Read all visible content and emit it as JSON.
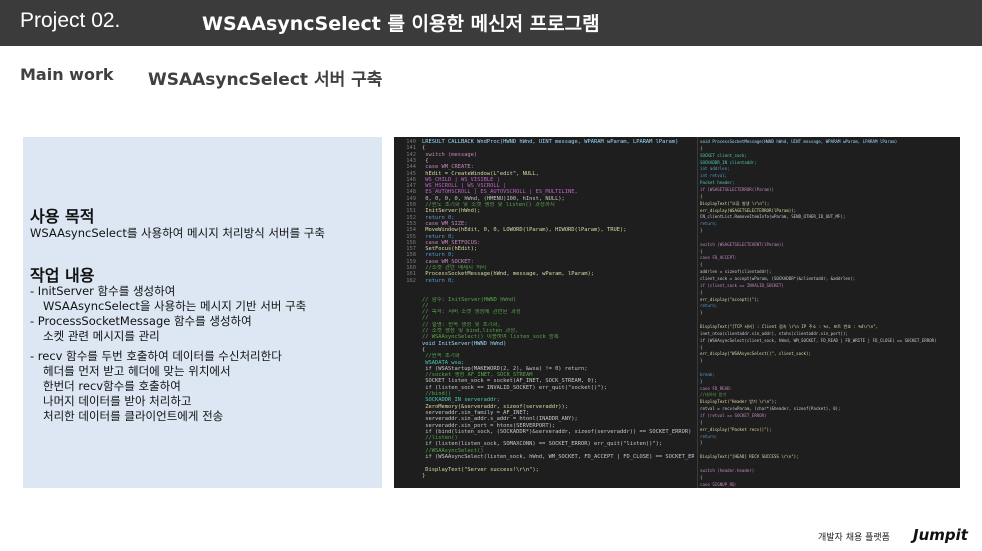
{
  "header": {
    "project": "Project  02.",
    "title": "WSAAsyncSelect 를 이용한 메신저 프로그램"
  },
  "main_work": "Main work",
  "subtitle": "WSAAsyncSelect 서버 구축",
  "left": {
    "purpose_heading": "사용 목적",
    "purpose_text": "WSAAsyncSelect를 사용하여 메시지 처리방식 서버를 구축",
    "work_heading": "작업 내용",
    "lines": [
      "-  InitServer 함수를 생성하여",
      "WSAAsyncSelect을 사용하는 메시지 기반 서버 구축",
      "-  ProcessSocketMessage 함수를 생성하여",
      "소켓 관련 메시지를 관리",
      "-  recv 함수를 두번 호출하여 데이터를 수신처리한다",
      "헤더를 먼저 받고 헤더에 맞는 위치에서",
      "한번더 recv함수를 호출하여",
      "나머지 데이터를 받아 처리하고",
      "처리한 데이터를 클라이언트에게 전송"
    ]
  },
  "code_left": [
    {
      "n": "140",
      "t": "LRESULT CALLBACK WndProc(HWND hWnd, UINT message, WPARAM wParam, LPARAM lParam)",
      "c": "#9cdcfe"
    },
    {
      "n": "141",
      "t": "{",
      "c": "#c8c8c8"
    },
    {
      "n": "142",
      "t": "    switch (message)",
      "c": "#c586c0"
    },
    {
      "n": "143",
      "t": "    {",
      "c": "#c8c8c8"
    },
    {
      "n": "144",
      "t": "    case WM_CREATE:",
      "c": "#c586c0"
    },
    {
      "n": "145",
      "t": "        hEdit = CreateWindow(L\"edit\", NULL,",
      "c": "#dcdcaa"
    },
    {
      "n": "146",
      "t": "            WS_CHILD | WS_VISIBLE |",
      "c": "#bd63c5"
    },
    {
      "n": "147",
      "t": "            WS_HSCROLL | WS_VSCROLL |",
      "c": "#bd63c5"
    },
    {
      "n": "148",
      "t": "            ES_AUTOHSCROLL | ES_AUTOVSCROLL | ES_MULTILINE,",
      "c": "#bd63c5"
    },
    {
      "n": "149",
      "t": "            0, 0, 0, 0, hWnd, (HMENU)100, hInst, NULL);",
      "c": "#c8c8c8"
    },
    {
      "n": "150",
      "t": "        //윈도 초기화 및 소켓 생성 및 listen() 과정까지",
      "c": "#57a64a"
    },
    {
      "n": "151",
      "t": "        InitServer(hWnd);",
      "c": "#dcdcaa"
    },
    {
      "n": "152",
      "t": "        return 0;",
      "c": "#569cd6"
    },
    {
      "n": "153",
      "t": "    case WM_SIZE:",
      "c": "#c586c0"
    },
    {
      "n": "154",
      "t": "        MoveWindow(hEdit, 0, 0, LOWORD(lParam), HIWORD(lParam), TRUE);",
      "c": "#dcdcaa"
    },
    {
      "n": "155",
      "t": "        return 0;",
      "c": "#569cd6"
    },
    {
      "n": "156",
      "t": "    case WM_SETFOCUS:",
      "c": "#c586c0"
    },
    {
      "n": "157",
      "t": "        SetFocus(hEdit);",
      "c": "#dcdcaa"
    },
    {
      "n": "158",
      "t": "        return 0;",
      "c": "#569cd6"
    },
    {
      "n": "159",
      "t": "    case WM_SOCKET:",
      "c": "#c586c0"
    },
    {
      "n": "160",
      "t": "        //소켓 관련 메세지 처리",
      "c": "#57a64a"
    },
    {
      "n": "161",
      "t": "        ProcessSocketMessage(hWnd, message, wParam, lParam);",
      "c": "#dcdcaa"
    },
    {
      "n": "162",
      "t": "        return 0;",
      "c": "#569cd6"
    },
    {
      "n": "",
      "t": "",
      "c": "#c8c8c8"
    },
    {
      "n": "",
      "t": "",
      "c": "#c8c8c8"
    },
    {
      "n": "",
      "t": "//  함수: InitServer(HWND hWnd)",
      "c": "#57a64a"
    },
    {
      "n": "",
      "t": "//",
      "c": "#57a64a"
    },
    {
      "n": "",
      "t": "//  목적:  서버 소켓 생성에 관련된 과정",
      "c": "#57a64a"
    },
    {
      "n": "",
      "t": "//",
      "c": "#57a64a"
    },
    {
      "n": "",
      "t": "//  설명:  윈속 생성 및 초기화,",
      "c": "#57a64a"
    },
    {
      "n": "",
      "t": "//        소켓 생성 및 bind,listen 과정,",
      "c": "#57a64a"
    },
    {
      "n": "",
      "t": "//        WSAAsyncSelect() 이용하여 listen_sock 등록",
      "c": "#57a64a"
    },
    {
      "n": "",
      "t": "void InitServer(HWND hWnd)",
      "c": "#9cdcfe"
    },
    {
      "n": "",
      "t": "{",
      "c": "#c8c8c8"
    },
    {
      "n": "",
      "t": "    //윈속 초기화",
      "c": "#57a64a"
    },
    {
      "n": "",
      "t": "    WSADATA wsa;",
      "c": "#4ec9b0"
    },
    {
      "n": "",
      "t": "    if (WSAStartup(MAKEWORD(2, 2), &wsa) != 0)  return;",
      "c": "#c8c8c8"
    },
    {
      "n": "",
      "t": "    //socket 생성 AF_INET, SOCK_STREAM",
      "c": "#57a64a"
    },
    {
      "n": "",
      "t": "    SOCKET listen_sock = socket(AF_INET, SOCK_STREAM, 0);",
      "c": "#c8c8c8"
    },
    {
      "n": "",
      "t": "    if (listen_sock == INVALID_SOCKET) err_quit(\"socket()\");",
      "c": "#c8c8c8"
    },
    {
      "n": "",
      "t": "    //bind()",
      "c": "#57a64a"
    },
    {
      "n": "",
      "t": "    SOCKADDR_IN serveraddr;",
      "c": "#4ec9b0"
    },
    {
      "n": "",
      "t": "    ZeroMemory(&serveraddr, sizeof(serveraddr));",
      "c": "#dcdcaa"
    },
    {
      "n": "",
      "t": "    serveraddr.sin_family = AF_INET;",
      "c": "#c8c8c8"
    },
    {
      "n": "",
      "t": "    serveraddr.sin_addr.s_addr = htonl(INADDR_ANY);",
      "c": "#c8c8c8"
    },
    {
      "n": "",
      "t": "    serveraddr.sin_port = htons(SERVERPORT);",
      "c": "#c8c8c8"
    },
    {
      "n": "",
      "t": "    if (bind(listen_sock, (SOCKADDR*)&serveraddr, sizeof(serveraddr)) == SOCKET_ERROR) err_quit(\"bind()\");",
      "c": "#c8c8c8"
    },
    {
      "n": "",
      "t": "    //listen()",
      "c": "#57a64a"
    },
    {
      "n": "",
      "t": "    if (listen(listen_sock, SOMAXCONN) == SOCKET_ERROR) err_quit(\"listen()\");",
      "c": "#c8c8c8"
    },
    {
      "n": "",
      "t": "    //WSAAsyncSelect()",
      "c": "#57a64a"
    },
    {
      "n": "",
      "t": "    if (WSAAsyncSelect(listen_sock, hWnd, WM_SOCKET, FD_ACCEPT | FD_CLOSE) == SOCKET_ERROR) err_quit(\"WSAAsyncSelect()\");",
      "c": "#c8c8c8"
    },
    {
      "n": "",
      "t": "",
      "c": "#c8c8c8"
    },
    {
      "n": "",
      "t": "    DisplayText(\"Server success!\\r\\n\");",
      "c": "#dcdcaa"
    },
    {
      "n": "",
      "t": "}",
      "c": "#c8c8c8"
    }
  ],
  "code_right": [
    {
      "t": "void ProcessSocketMessage(HWND hWnd, UINT message, WPARAM wParam, LPARAM lParam)",
      "c": "#9cdcfe"
    },
    {
      "t": "{",
      "c": "#c8c8c8"
    },
    {
      "t": "    SOCKET      client_sock;",
      "c": "#4ec9b0"
    },
    {
      "t": "    SOCKADDR_IN clientaddr;",
      "c": "#4ec9b0"
    },
    {
      "t": "    int         addrlen;",
      "c": "#569cd6"
    },
    {
      "t": "    int         retval;",
      "c": "#569cd6"
    },
    {
      "t": "    Packet      header;",
      "c": "#4ec9b0"
    },
    {
      "t": "    if (WSAGETSELECTERROR(lParam))",
      "c": "#c586c0"
    },
    {
      "t": "    {",
      "c": "#c8c8c8"
    },
    {
      "t": "        DisplayText(\"오류 발생 \\r\\n\");",
      "c": "#dcdcaa"
    },
    {
      "t": "        err_display(WSAGETSELECTERROR(lParam));",
      "c": "#dcdcaa"
    },
    {
      "t": "        CN_clientList.RemoveItemInfo(wParam, SEND_OTHER_ID_OUT_MF);",
      "c": "#c8c8c8"
    },
    {
      "t": "        return;",
      "c": "#569cd6"
    },
    {
      "t": "    }",
      "c": "#c8c8c8"
    },
    {
      "t": "",
      "c": "#c8c8c8"
    },
    {
      "t": "    switch (WSAGETSELECTEVENT(lParam))",
      "c": "#c586c0"
    },
    {
      "t": "    {",
      "c": "#c8c8c8"
    },
    {
      "t": "    case FD_ACCEPT:",
      "c": "#c586c0"
    },
    {
      "t": "        {",
      "c": "#c8c8c8"
    },
    {
      "t": "        addrlen = sizeof(clientaddr);",
      "c": "#c8c8c8"
    },
    {
      "t": "        client_sock = accept(wParam, (SOCKADDR*)&clientaddr, &addrlen);",
      "c": "#c8c8c8"
    },
    {
      "t": "        if (client_sock == INVALID_SOCKET)",
      "c": "#c586c0"
    },
    {
      "t": "        {",
      "c": "#c8c8c8"
    },
    {
      "t": "            err_display(\"accept()\");",
      "c": "#dcdcaa"
    },
    {
      "t": "            return;",
      "c": "#569cd6"
    },
    {
      "t": "        }",
      "c": "#c8c8c8"
    },
    {
      "t": "",
      "c": "#c8c8c8"
    },
    {
      "t": "        DisplayText(\"[TCP 서버] : Client 접속 \\r\\n IP 주소 : %s, 포트 번호 : %d\\r\\n\",",
      "c": "#dcdcaa"
    },
    {
      "t": "            inet_ntoa(clientaddr.sin_addr), ntohs(clientaddr.sin_port));",
      "c": "#c8c8c8"
    },
    {
      "t": "        if (WSAAsyncSelect(client_sock, hWnd, WM_SOCKET, FD_READ | FD_WRITE | FD_CLOSE) == SOCKET_ERROR)",
      "c": "#c8c8c8"
    },
    {
      "t": "        {",
      "c": "#c8c8c8"
    },
    {
      "t": "            err_display(\"WSAAsyncSelect()\", client_sock);",
      "c": "#dcdcaa"
    },
    {
      "t": "        }",
      "c": "#c8c8c8"
    },
    {
      "t": "",
      "c": "#c8c8c8"
    },
    {
      "t": "        break;",
      "c": "#569cd6"
    },
    {
      "t": "        }",
      "c": "#c8c8c8"
    },
    {
      "t": "    case FD_READ:",
      "c": "#c586c0"
    },
    {
      "t": "        //데이터 받기",
      "c": "#57a64a"
    },
    {
      "t": "        DisplayText(\"Header 받기 \\r\\n\");",
      "c": "#dcdcaa"
    },
    {
      "t": "        retval = recv(wParam, (char*)&header, sizeof(Packet), 0);",
      "c": "#c8c8c8"
    },
    {
      "t": "        if (retval == SOCKET_ERROR)",
      "c": "#c586c0"
    },
    {
      "t": "        {",
      "c": "#c8c8c8"
    },
    {
      "t": "            err_display(\"Packet recv()\");",
      "c": "#dcdcaa"
    },
    {
      "t": "            return;",
      "c": "#569cd6"
    },
    {
      "t": "        }",
      "c": "#c8c8c8"
    },
    {
      "t": "",
      "c": "#c8c8c8"
    },
    {
      "t": "        DisplayText(\"[HEAD] RECV SUCCESS \\r\\n\");",
      "c": "#dcdcaa"
    },
    {
      "t": "",
      "c": "#c8c8c8"
    },
    {
      "t": "        switch (header.header)",
      "c": "#c586c0"
    },
    {
      "t": "        {",
      "c": "#c8c8c8"
    },
    {
      "t": "        case SIGNUP_RQ:",
      "c": "#c586c0"
    }
  ],
  "footer": {
    "text": "개발자 채용 플랫폼",
    "logo": "Jumpit"
  }
}
